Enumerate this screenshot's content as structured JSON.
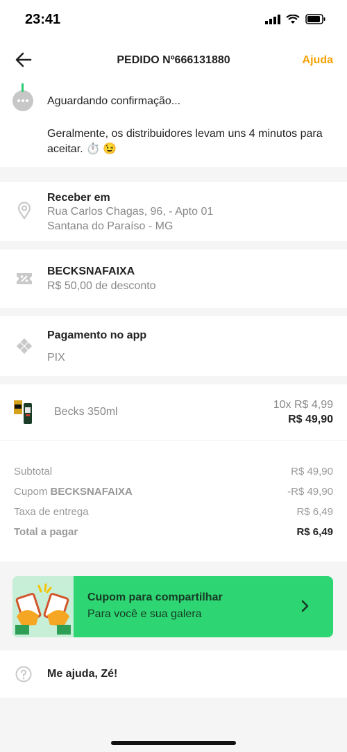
{
  "status_bar": {
    "time": "23:41"
  },
  "header": {
    "title": "PEDIDO Nº666131880",
    "help": "Ajuda"
  },
  "order_status": {
    "title": "Aguardando confirmação...",
    "info": "Geralmente, os distribuidores levam uns 4 minutos para aceitar. ⏱️ 😉"
  },
  "address": {
    "label": "Receber em",
    "line1": "Rua Carlos Chagas, 96,  - Apto 01",
    "line2": "Santana do Paraíso - MG"
  },
  "coupon": {
    "code": "BECKSNAFAIXA",
    "discount": "R$ 50,00 de desconto"
  },
  "payment": {
    "label": "Pagamento no app",
    "method": "PIX"
  },
  "item": {
    "name": "Becks 350ml",
    "qty_price": "10x R$ 4,99",
    "total": "R$ 49,90"
  },
  "summary": {
    "subtotal_label": "Subtotal",
    "subtotal": "R$ 49,90",
    "coupon_prefix": "Cupom",
    "coupon_code": "BECKSNAFAIXA",
    "coupon_value": "-R$ 49,90",
    "delivery_label": "Taxa de entrega",
    "delivery": "R$ 6,49",
    "total_label": "Total a pagar",
    "total": "R$ 6,49"
  },
  "share_banner": {
    "title": "Cupom para compartilhar",
    "subtitle": "Para você e sua galera"
  },
  "support": {
    "label": "Me ajuda, Zé!"
  },
  "colors": {
    "accent": "#f5a000",
    "green": "#2ed573",
    "status_line": "#2ecc71"
  }
}
